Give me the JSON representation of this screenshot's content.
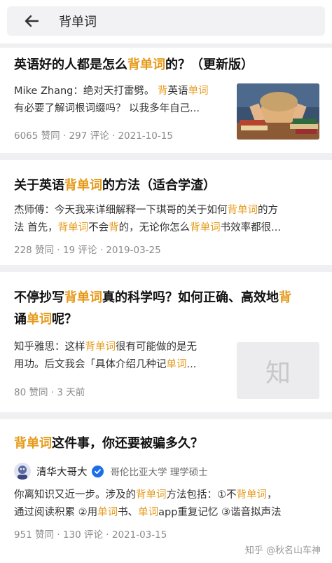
{
  "search": {
    "query": "背单词"
  },
  "results": [
    {
      "title_parts": [
        "英语好的人都是怎么",
        "背单词",
        "的？（更新版）"
      ],
      "excerpt_line1_parts": [
        "Mike Zhang：绝对天打雷劈。 ",
        "背",
        "英语",
        "单词"
      ],
      "excerpt_line2": "有必要了解词根词缀吗？ 以我多年自己...",
      "meta": "6065 赞同 · 297 评论 · 2021-10-15"
    },
    {
      "title_parts": [
        "关于英语",
        "背单词",
        "的方法（适合学渣）"
      ],
      "excerpt_line1_parts": [
        "杰师傅：今天我来详细解释一下琪哥的关于如何",
        "背单词",
        "的方"
      ],
      "excerpt_line2_parts": [
        "法 首先，",
        "背单词",
        "不会",
        "背",
        "的，无论你怎么",
        "背单词",
        "书效率都很..."
      ],
      "meta": "228 赞同 · 19 评论 · 2019-03-25"
    },
    {
      "title_line1_parts": [
        "不停抄写",
        "背单词",
        "真的科学吗？如何正确、高效地",
        "背"
      ],
      "title_line2_parts": [
        "诵",
        "单词",
        "呢？"
      ],
      "excerpt_line1_parts": [
        "知乎雅思：这样",
        "背单词",
        "很有可能做的是无"
      ],
      "excerpt_line2_parts": [
        "用功。后文我会「具体介绍几种记",
        "单词",
        "..."
      ],
      "meta": "80 赞同 · 3 天前",
      "thumb_text": "知"
    },
    {
      "title_parts": [
        "背单词",
        "这件事，你还要被骗多久？"
      ],
      "author_name": "清华大哥大",
      "author_desc": "哥伦比亚大学 理学硕士",
      "excerpt_line1_parts": [
        "你离知识又近一步。涉及的",
        "背单词",
        "方法包括：①不",
        "背单词",
        "，"
      ],
      "excerpt_line2_parts": [
        "通过阅读积累 ②用",
        "单词",
        "书、",
        "单词",
        "app重复记忆 ③谐音拟声法"
      ],
      "meta": "951 赞同 · 130 评论 · 2021-03-15"
    }
  ],
  "watermark": "知乎 @秋名山车神",
  "colors": {
    "highlight": "#e69a1a",
    "meta": "#8a8a8a",
    "verified": "#1a6fe8"
  },
  "icons": [
    "back-arrow-icon",
    "verified-badge-icon"
  ]
}
